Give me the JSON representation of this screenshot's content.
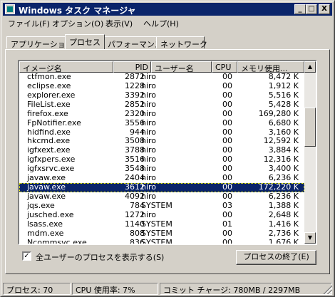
{
  "window": {
    "title": "Windows タスク マネージャ",
    "minimize": "_",
    "maximize": "□",
    "close": "X"
  },
  "menu": [
    "ファイル(F)",
    "オプション(O)",
    "表示(V)",
    "ヘルプ(H)"
  ],
  "tabs": [
    "アプリケーション",
    "プロセス",
    "パフォーマンス",
    "ネットワーク"
  ],
  "active_tab": "プロセス",
  "table": {
    "headers": [
      "イメージ名",
      "PID",
      "ユーザー名",
      "CPU",
      "メモリ使用..."
    ],
    "rows": [
      [
        "ctfmon.exe",
        "2872",
        "hiro",
        "00",
        "8,472 K"
      ],
      [
        "eclipse.exe",
        "1228",
        "hiro",
        "00",
        "1,912 K"
      ],
      [
        "explorer.exe",
        "3392",
        "hiro",
        "00",
        "5,516 K"
      ],
      [
        "FileList.exe",
        "2852",
        "hiro",
        "00",
        "5,428 K"
      ],
      [
        "firefox.exe",
        "2320",
        "hiro",
        "00",
        "169,280 K"
      ],
      [
        "FpNotifier.exe",
        "3556",
        "hiro",
        "00",
        "6,680 K"
      ],
      [
        "hidfind.exe",
        "944",
        "hiro",
        "00",
        "3,160 K"
      ],
      [
        "hkcmd.exe",
        "3508",
        "hiro",
        "00",
        "12,592 K"
      ],
      [
        "igfxext.exe",
        "3788",
        "hiro",
        "00",
        "3,884 K"
      ],
      [
        "igfxpers.exe",
        "3516",
        "hiro",
        "00",
        "12,316 K"
      ],
      [
        "igfxsrvc.exe",
        "3548",
        "hiro",
        "00",
        "3,400 K"
      ],
      [
        "javaw.exe",
        "2404",
        "hiro",
        "00",
        "6,236 K"
      ],
      [
        "javaw.exe",
        "3612",
        "hiro",
        "00",
        "172,220 K"
      ],
      [
        "javaw.exe",
        "4092",
        "hiro",
        "00",
        "6,236 K"
      ],
      [
        "jqs.exe",
        "784",
        "SYSTEM",
        "03",
        "1,388 K"
      ],
      [
        "jusched.exe",
        "1272",
        "hiro",
        "00",
        "2,648 K"
      ],
      [
        "lsass.exe",
        "1140",
        "SYSTEM",
        "01",
        "1,416 K"
      ],
      [
        "mdm.exe",
        "808",
        "SYSTEM",
        "00",
        "2,736 K"
      ],
      [
        "Ncommsvc.exe",
        "836",
        "SYSTEM",
        "00",
        "1,676 K"
      ]
    ],
    "selected_index": 12
  },
  "show_all_users": {
    "checked": true,
    "mark": "✓",
    "label": "全ユーザーのプロセスを表示する(S)"
  },
  "end_process_button": "プロセスの終了(E)",
  "status": {
    "processes": "プロセス: 70",
    "cpu": "CPU 使用率: 7%",
    "commit": "コミット チャージ: 780MB / 2297MB"
  },
  "colors": {
    "face": "#d4d0c8",
    "title_bg": "#0a246a",
    "selection": "#0a246a"
  }
}
